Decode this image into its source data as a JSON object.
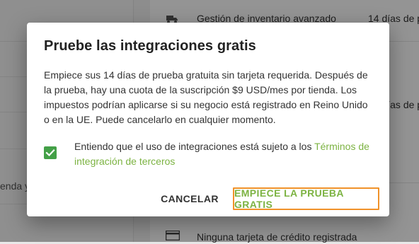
{
  "background": {
    "items": [
      {
        "label": "Gestión de inventario avanzado",
        "trailing": "14 días de p"
      },
      {
        "trailing": "14 días de p"
      },
      {
        "label": "Ninguna tarjeta de crédito registrada"
      }
    ],
    "left_fragment": "enda y"
  },
  "dialog": {
    "title": "Pruebe las integraciones gratis",
    "body": "Empiece sus 14 días de prueba gratuita sin tarjeta requerida. Después de la prueba, hay una cuota de la suscripción $9 USD/mes por tienda. Los impuestos podrían aplicarse si su negocio está registrado en Reino Unido o en la UE. Puede cancelarlo en cualquier momento.",
    "consent": {
      "checked": true,
      "text": "Entiendo que el uso de integraciones está sujeto a los ",
      "link": "Términos de integración de terceros"
    },
    "cancel_label": "CANCELAR",
    "confirm_label": "EMPIECE LA PRUEBA GRATIS"
  },
  "colors": {
    "accent_green": "#7cb342",
    "checkbox_green": "#43a047",
    "highlight_orange": "#f0922a"
  }
}
